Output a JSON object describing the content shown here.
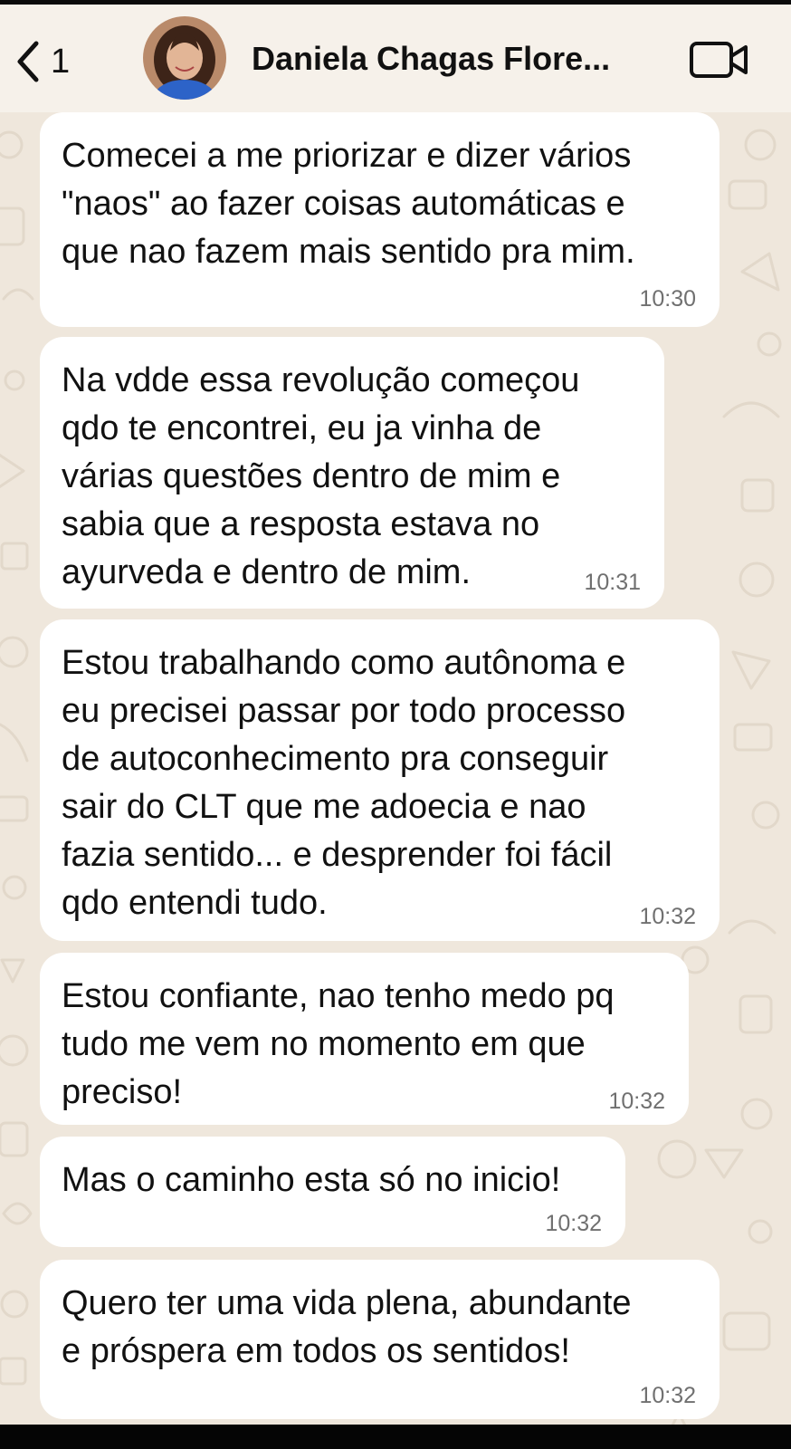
{
  "header": {
    "back_count": "1",
    "contact_name": "Daniela Chagas Flore...",
    "back_icon": "chevron-left-icon",
    "call_icon": "video-camera-icon"
  },
  "messages": [
    {
      "text": "Comecei a me priorizar e dizer vários\n\"naos\" ao fazer coisas automáticas e\nque nao fazem mais sentido pra mim.",
      "time": "10:30"
    },
    {
      "text": "Na vdde essa revolução começou\nqdo te encontrei, eu ja vinha de\nvárias questões dentro de mim e\nsabia que a resposta estava no\nayurveda e dentro de mim.",
      "time": "10:31"
    },
    {
      "text": "Estou trabalhando como autônoma e\neu precisei passar por todo processo\nde autoconhecimento pra conseguir\nsair do CLT que me adoecia e nao\nfazia sentido... e desprender foi fácil\nqdo entendi tudo.",
      "time": "10:32"
    },
    {
      "text": "Estou confiante, nao tenho medo pq\ntudo me vem no momento em que\npreciso!",
      "time": "10:32"
    },
    {
      "text": "Mas o caminho esta só no inicio!",
      "time": "10:32"
    },
    {
      "text": "Quero ter uma vida plena, abundante\ne próspera em todos os sentidos!",
      "time": "10:32"
    }
  ],
  "colors": {
    "background": "#efe7dc",
    "bubble": "#ffffff",
    "header": "#f6f1ea",
    "timestamp": "#707070"
  }
}
